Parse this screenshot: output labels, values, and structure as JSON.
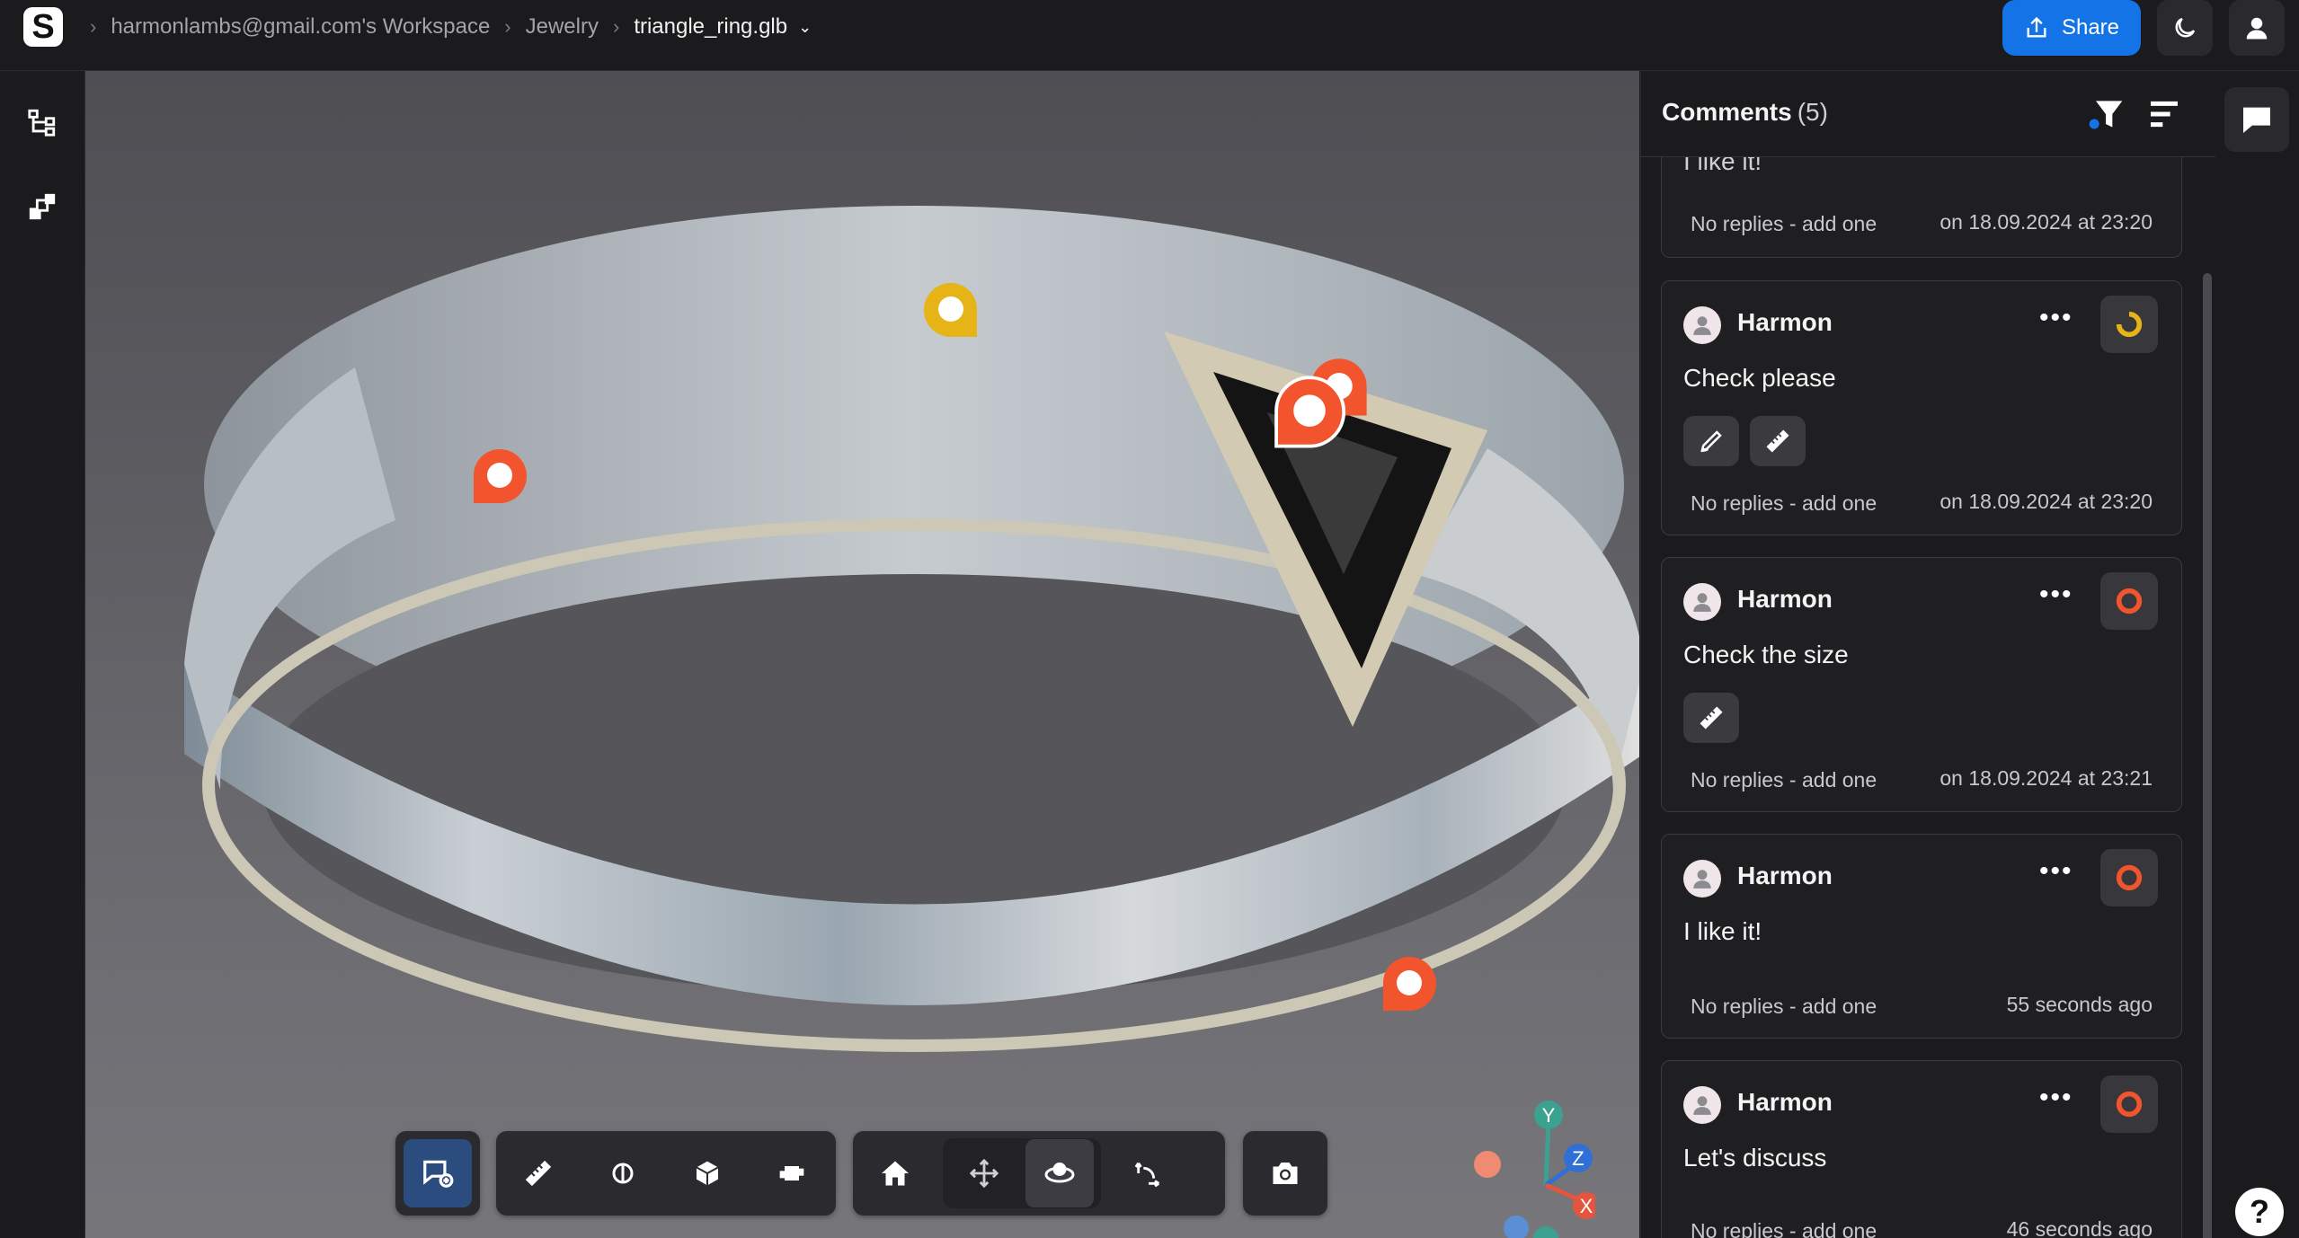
{
  "header": {
    "logo_letter": "S",
    "breadcrumbs": [
      "harmonlambs@gmail.com's Workspace",
      "Jewelry"
    ],
    "file_name": "triangle_ring.glb",
    "share_label": "Share"
  },
  "comments": {
    "title": "Comments",
    "count": "(5)",
    "partial_card": {
      "text": "I like it!",
      "replies": "No replies - add one",
      "date": "on 18.09.2024 at 23:20"
    },
    "items": [
      {
        "author": "Harmon",
        "text": "Check please",
        "status": "in-progress",
        "replies": "No replies - add one",
        "date": "on 18.09.2024 at 23:20",
        "attachments": [
          "markup-icon",
          "measure-icon"
        ]
      },
      {
        "author": "Harmon",
        "text": "Check the size",
        "status": "open",
        "replies": "No replies - add one",
        "date": "on 18.09.2024 at 23:21",
        "attachments": [
          "measure-icon"
        ]
      },
      {
        "author": "Harmon",
        "text": "I like it!",
        "status": "open",
        "replies": "No replies - add one",
        "date": "55 seconds ago",
        "attachments": []
      },
      {
        "author": "Harmon",
        "text": "Let's discuss",
        "status": "open",
        "replies": "No replies - add one",
        "date": "46 seconds ago",
        "attachments": []
      }
    ]
  },
  "toolbar": {
    "tools": [
      "add-comment",
      "measure",
      "section",
      "box-view",
      "explode",
      "home",
      "pan",
      "orbit",
      "rotate",
      "screenshot"
    ]
  },
  "gizmo": {
    "x_label": "X",
    "y_label": "Y",
    "z_label": "Z"
  },
  "help_label": "?",
  "colors": {
    "accent": "#1473e6",
    "pin_red": "#f2542d",
    "pin_yellow": "#e6b417",
    "status_open": "#f2542d",
    "status_progress": "#e6b417"
  }
}
